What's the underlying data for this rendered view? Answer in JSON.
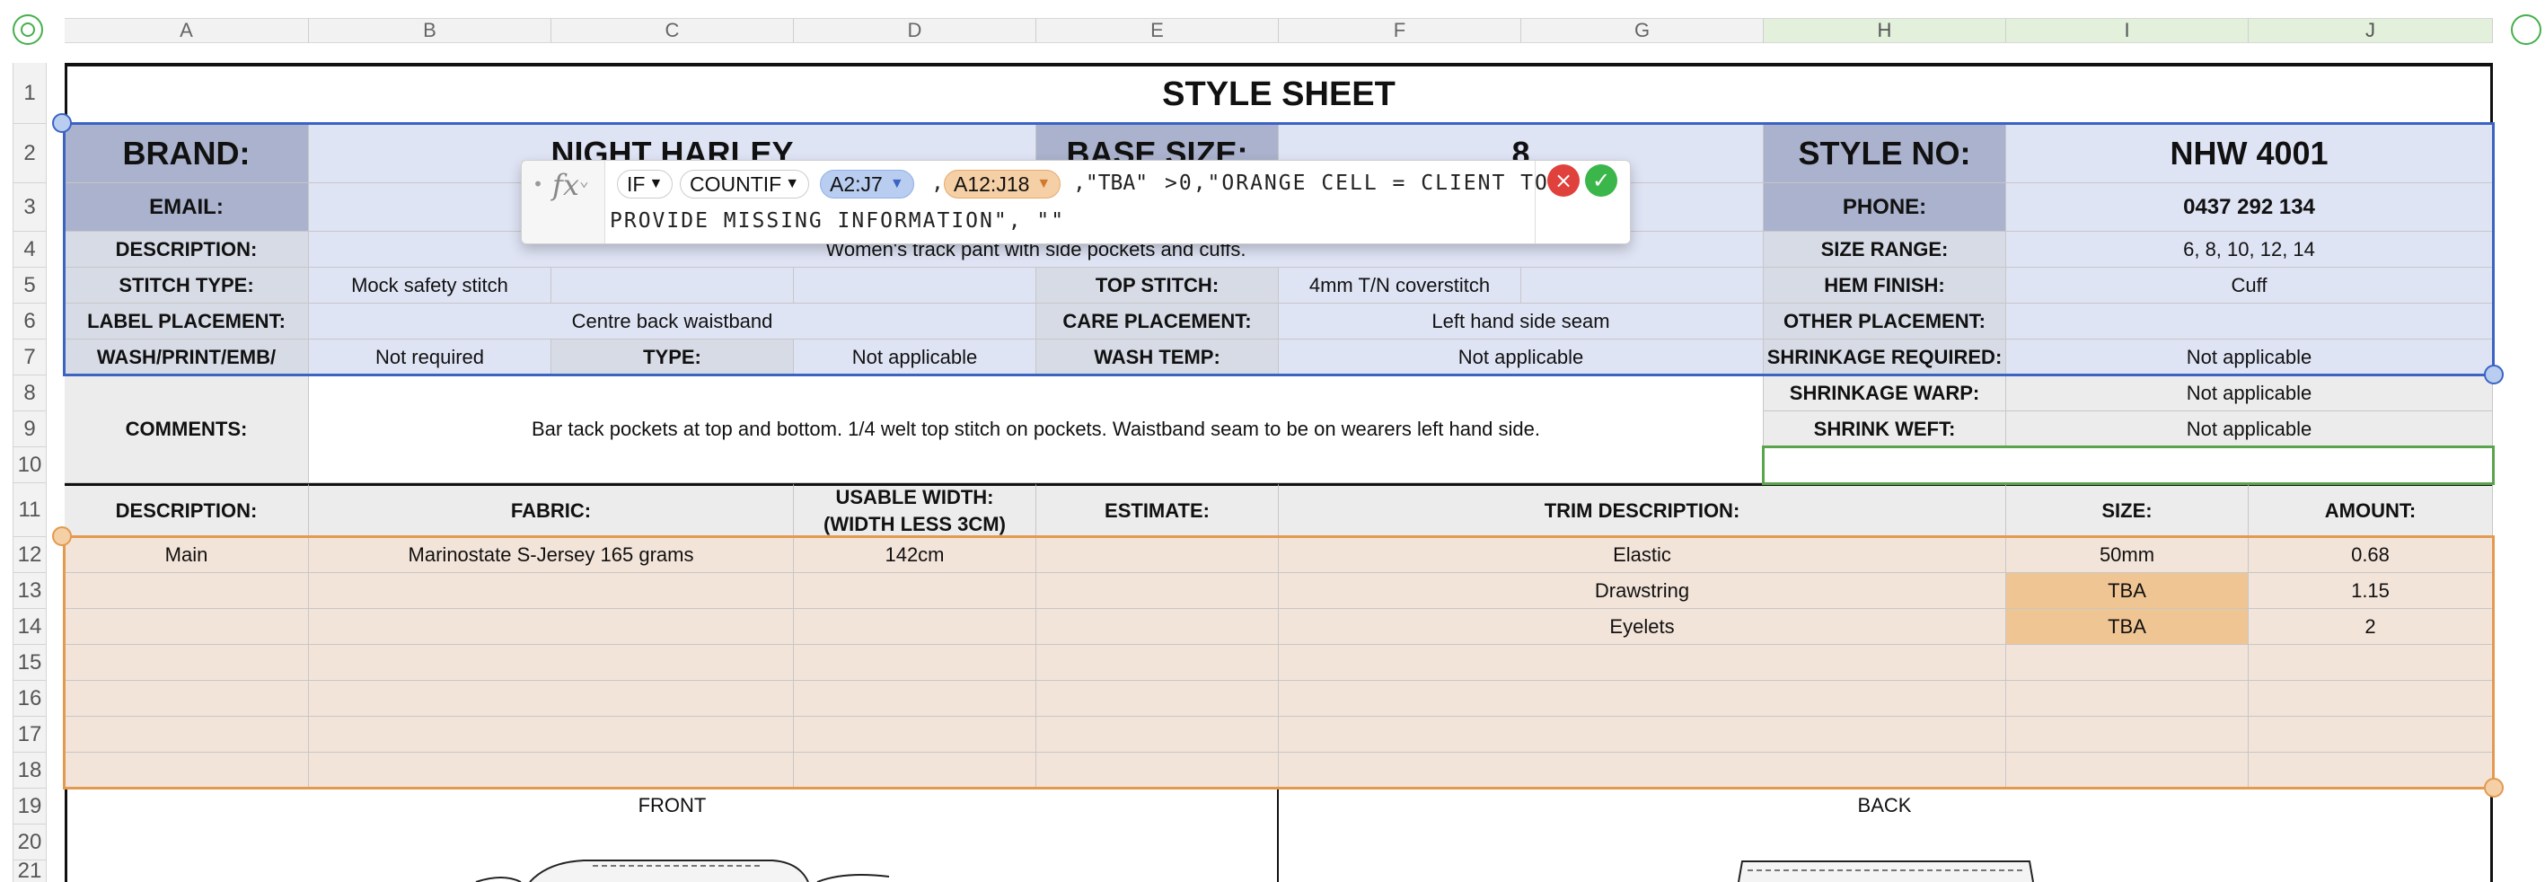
{
  "columns": [
    "A",
    "B",
    "C",
    "D",
    "E",
    "F",
    "G",
    "H",
    "I",
    "J"
  ],
  "rows": [
    "1",
    "2",
    "3",
    "4",
    "5",
    "6",
    "7",
    "8",
    "9",
    "10",
    "11",
    "12",
    "13",
    "14",
    "15",
    "16",
    "17",
    "18",
    "19",
    "20",
    "21"
  ],
  "sheet": {
    "title": "STYLE SHEET",
    "brand_label": "BRAND:",
    "brand_value": "NIGHT HARLEY",
    "base_size_label": "BASE SIZE:",
    "base_size_value": "8",
    "style_no_label": "STYLE NO:",
    "style_no_value": "NHW 4001",
    "email_label": "EMAIL:",
    "phone_label": "PHONE:",
    "phone_value": "0437 292 134",
    "description_label": "DESCRIPTION:",
    "description_value": "Women's track pant with side pockets and cuffs.",
    "size_range_label": "SIZE RANGE:",
    "size_range_value": "6, 8, 10, 12, 14",
    "stitch_type_label": "STITCH TYPE:",
    "stitch_type_value": "Mock safety stitch",
    "top_stitch_label": "TOP STITCH:",
    "top_stitch_value": "4mm T/N coverstitch",
    "hem_finish_label": "HEM FINISH:",
    "hem_finish_value": "Cuff",
    "label_placement_label": "LABEL PLACEMENT:",
    "label_placement_value": "Centre back waistband",
    "care_placement_label": "CARE PLACEMENT:",
    "care_placement_value": "Left hand side seam",
    "other_placement_label": "OTHER PLACEMENT:",
    "wash_label": "WASH/PRINT/EMB/",
    "wash_value": "Not required",
    "type_label": "TYPE:",
    "type_value": "Not applicable",
    "wash_temp_label": "WASH TEMP:",
    "wash_temp_value": "Not applicable",
    "shrinkage_label": "SHRINKAGE REQUIRED:",
    "shrinkage_value": "Not applicable",
    "shrink_warp_label": "SHRINKAGE WARP:",
    "shrink_warp_value": "Not applicable",
    "shrink_weft_label": "SHRINK WEFT:",
    "shrink_weft_value": "Not applicable",
    "comments_label": "COMMENTS:",
    "comments_value": "Bar tack pockets at top and bottom.  1/4 welt top stitch on pockets.  Waistband seam to be on wearers left hand side.",
    "fabric_headers": {
      "description": "DESCRIPTION:",
      "fabric": "FABRIC:",
      "usable_width_1": "USABLE WIDTH:",
      "usable_width_2": "(WIDTH LESS 3CM)",
      "estimate": "ESTIMATE:",
      "trim_description": "TRIM DESCRIPTION:",
      "size": "SIZE:",
      "amount": "AMOUNT:"
    },
    "fabric_rows": [
      {
        "description": "Main",
        "fabric": "Marinostate S-Jersey 165 grams",
        "width": "142cm",
        "estimate": "",
        "trim": "Elastic",
        "size": "50mm",
        "amount": "0.68"
      },
      {
        "description": "",
        "fabric": "",
        "width": "",
        "estimate": "",
        "trim": "Drawstring",
        "size": "TBA",
        "amount": "1.15"
      },
      {
        "description": "",
        "fabric": "",
        "width": "",
        "estimate": "",
        "trim": "Eyelets",
        "size": "TBA",
        "amount": "2"
      }
    ],
    "front_label": "FRONT",
    "back_label": "BACK"
  },
  "formula": {
    "fn_if": "IF",
    "fn_countif": "COUNTIF",
    "ref1": "A2:J7",
    "comma": ",",
    "ref2": "A12:J18",
    "text1": ",\"TBA\"",
    "text2": ">0,\"ORANGE CELL = CLIENT TO",
    "text3": "PROVIDE MISSING INFORMATION\", \"\"",
    "cancel_icon": "×",
    "accept_icon": "✓"
  },
  "colors": {
    "label_fill": "#aab2cd",
    "value_fill": "#dfe4f5",
    "trim_fill": "#f3e4d9",
    "missing_fill": "#efc594",
    "selection_blue": "#3b63c4",
    "selection_orange": "#e39a4f"
  }
}
